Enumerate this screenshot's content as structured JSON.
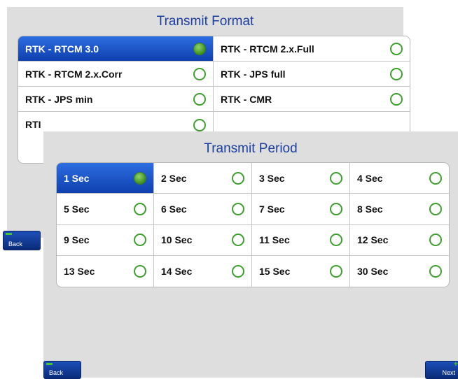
{
  "format": {
    "title": "Transmit Format",
    "options": [
      {
        "label": "RTK - RTCM 3.0",
        "selected": true
      },
      {
        "label": "RTK - RTCM 2.x.Full",
        "selected": false
      },
      {
        "label": "RTK - RTCM 2.x.Corr",
        "selected": false
      },
      {
        "label": "RTK - JPS full",
        "selected": false
      },
      {
        "label": "RTK - JPS min",
        "selected": false
      },
      {
        "label": "RTK - CMR",
        "selected": false
      },
      {
        "label": "RTI",
        "selected": false
      },
      {
        "label": "",
        "selected": false
      }
    ]
  },
  "period": {
    "title": "Transmit Period",
    "options": [
      {
        "label": "1 Sec",
        "selected": true
      },
      {
        "label": "2 Sec",
        "selected": false
      },
      {
        "label": "3 Sec",
        "selected": false
      },
      {
        "label": "4 Sec",
        "selected": false
      },
      {
        "label": "5 Sec",
        "selected": false
      },
      {
        "label": "6 Sec",
        "selected": false
      },
      {
        "label": "7 Sec",
        "selected": false
      },
      {
        "label": "8 Sec",
        "selected": false
      },
      {
        "label": "9 Sec",
        "selected": false
      },
      {
        "label": "10 Sec",
        "selected": false
      },
      {
        "label": "11 Sec",
        "selected": false
      },
      {
        "label": "12 Sec",
        "selected": false
      },
      {
        "label": "13 Sec",
        "selected": false
      },
      {
        "label": "14 Sec",
        "selected": false
      },
      {
        "label": "15 Sec",
        "selected": false
      },
      {
        "label": "30 Sec",
        "selected": false
      }
    ]
  },
  "buttons": {
    "back": "Back",
    "next": "Next"
  },
  "colors": {
    "title": "#1c3f9e",
    "selected_bg": "#1f55c8",
    "radio": "#3f9e2f",
    "panel_bg": "#dedede"
  },
  "icons": {
    "radio_on": "radio-selected-icon",
    "radio_off": "radio-unselected-icon"
  }
}
